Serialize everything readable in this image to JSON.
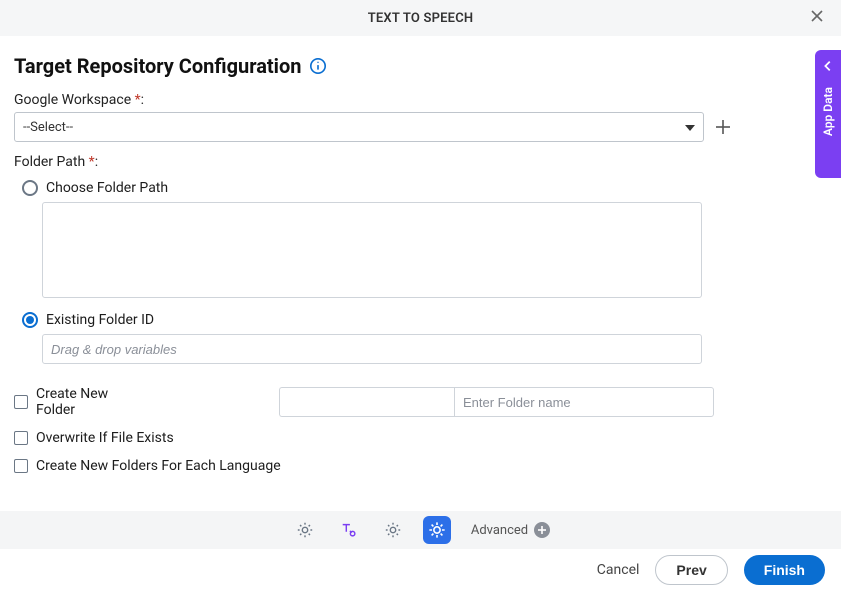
{
  "header": {
    "title": "TEXT TO SPEECH"
  },
  "sidetab": {
    "label": "App Data"
  },
  "page": {
    "title": "Target Repository Configuration"
  },
  "fields": {
    "workspace": {
      "label": "Google Workspace ",
      "required": "*",
      "suffix": ":",
      "value": "--Select--"
    },
    "folderPath": {
      "label": "Folder Path ",
      "required": "*",
      "suffix": ":",
      "options": {
        "choose": {
          "label": "Choose Folder Path",
          "selected": false
        },
        "existing": {
          "label": "Existing Folder ID",
          "selected": true,
          "placeholder": "Drag & drop variables"
        }
      }
    },
    "createNew": {
      "label": "Create New Folder",
      "checked": false,
      "placeholder": "Enter Folder name"
    },
    "overwrite": {
      "label": "Overwrite If File Exists",
      "checked": false
    },
    "perLang": {
      "label": "Create New Folders For Each Language",
      "checked": false
    }
  },
  "footer": {
    "advanced": "Advanced",
    "cancel": "Cancel",
    "prev": "Prev",
    "finish": "Finish"
  }
}
